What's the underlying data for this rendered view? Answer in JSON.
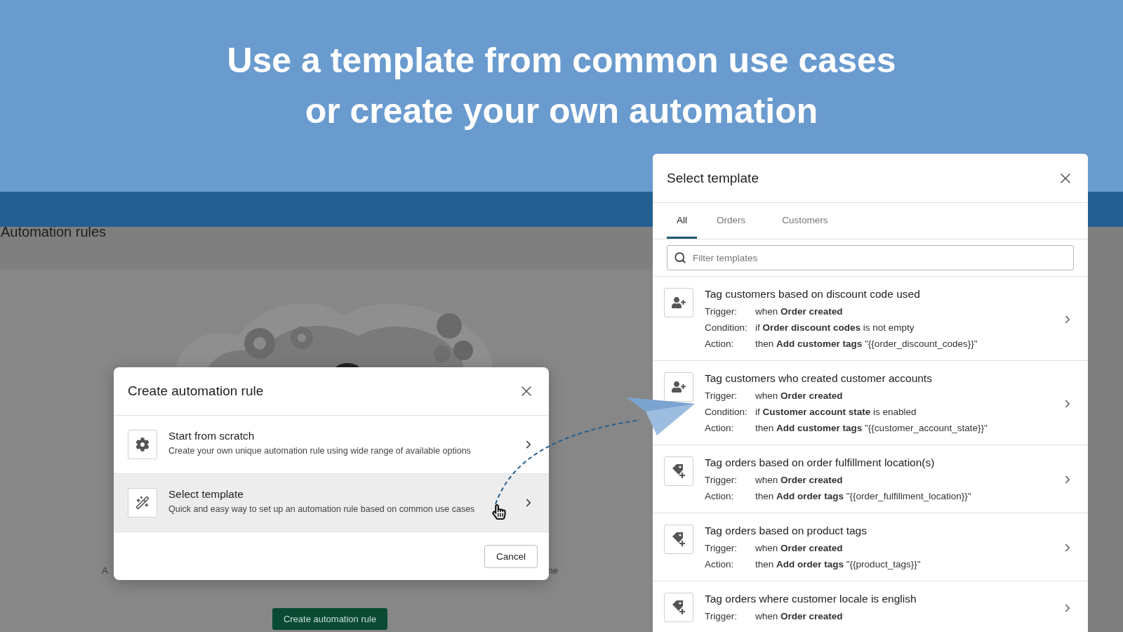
{
  "headline": [
    "Use a template from common use cases",
    "or create your own automation"
  ],
  "background_app": {
    "page_title": "Automation rules",
    "caption_start": "A",
    "caption_end": "ne",
    "primary_button": "Create automation rule"
  },
  "create_dialog": {
    "title": "Create automation rule",
    "options": [
      {
        "kind": "scratch",
        "title": "Start from scratch",
        "description": "Create your own unique automation rule using wide range of available options",
        "hovered": false
      },
      {
        "kind": "template",
        "title": "Select template",
        "description": "Quick and easy way to set up an automation rule based on common use cases",
        "hovered": true
      }
    ],
    "cancel": "Cancel"
  },
  "template_panel": {
    "title": "Select template",
    "tabs": [
      {
        "label": "All",
        "selected": true
      },
      {
        "label": "Orders",
        "selected": false
      },
      {
        "label": "Customers",
        "selected": false
      }
    ],
    "search": {
      "placeholder": "Filter templates"
    },
    "templates": [
      {
        "kind": "customer",
        "title": "Tag customers based on discount code used",
        "rules": [
          {
            "label": "Trigger:",
            "text": "when **Order created**"
          },
          {
            "label": "Condition:",
            "text": "if **Order discount codes** is not empty"
          },
          {
            "label": "Action:",
            "text": "then **Add customer tags** \"{{order_discount_codes}}\""
          }
        ]
      },
      {
        "kind": "customer",
        "title": "Tag customers who created customer accounts",
        "rules": [
          {
            "label": "Trigger:",
            "text": "when **Order created**"
          },
          {
            "label": "Condition:",
            "text": "if **Customer account state** is enabled"
          },
          {
            "label": "Action:",
            "text": "then **Add customer tags** \"{{customer_account_state}}\""
          }
        ]
      },
      {
        "kind": "order",
        "title": "Tag orders based on order fulfillment location(s)",
        "rules": [
          {
            "label": "Trigger:",
            "text": "when **Order created**"
          },
          {
            "label": "Action:",
            "text": "then **Add order tags** \"{{order_fulfillment_location}}\""
          }
        ]
      },
      {
        "kind": "order",
        "title": "Tag orders based on product tags",
        "rules": [
          {
            "label": "Trigger:",
            "text": "when **Order created**"
          },
          {
            "label": "Action:",
            "text": "then **Add order tags** \"{{product_tags}}\""
          }
        ]
      },
      {
        "kind": "order",
        "title": "Tag orders where customer locale is english",
        "rules": [
          {
            "label": "Trigger:",
            "text": "when **Order created**"
          }
        ]
      }
    ]
  }
}
